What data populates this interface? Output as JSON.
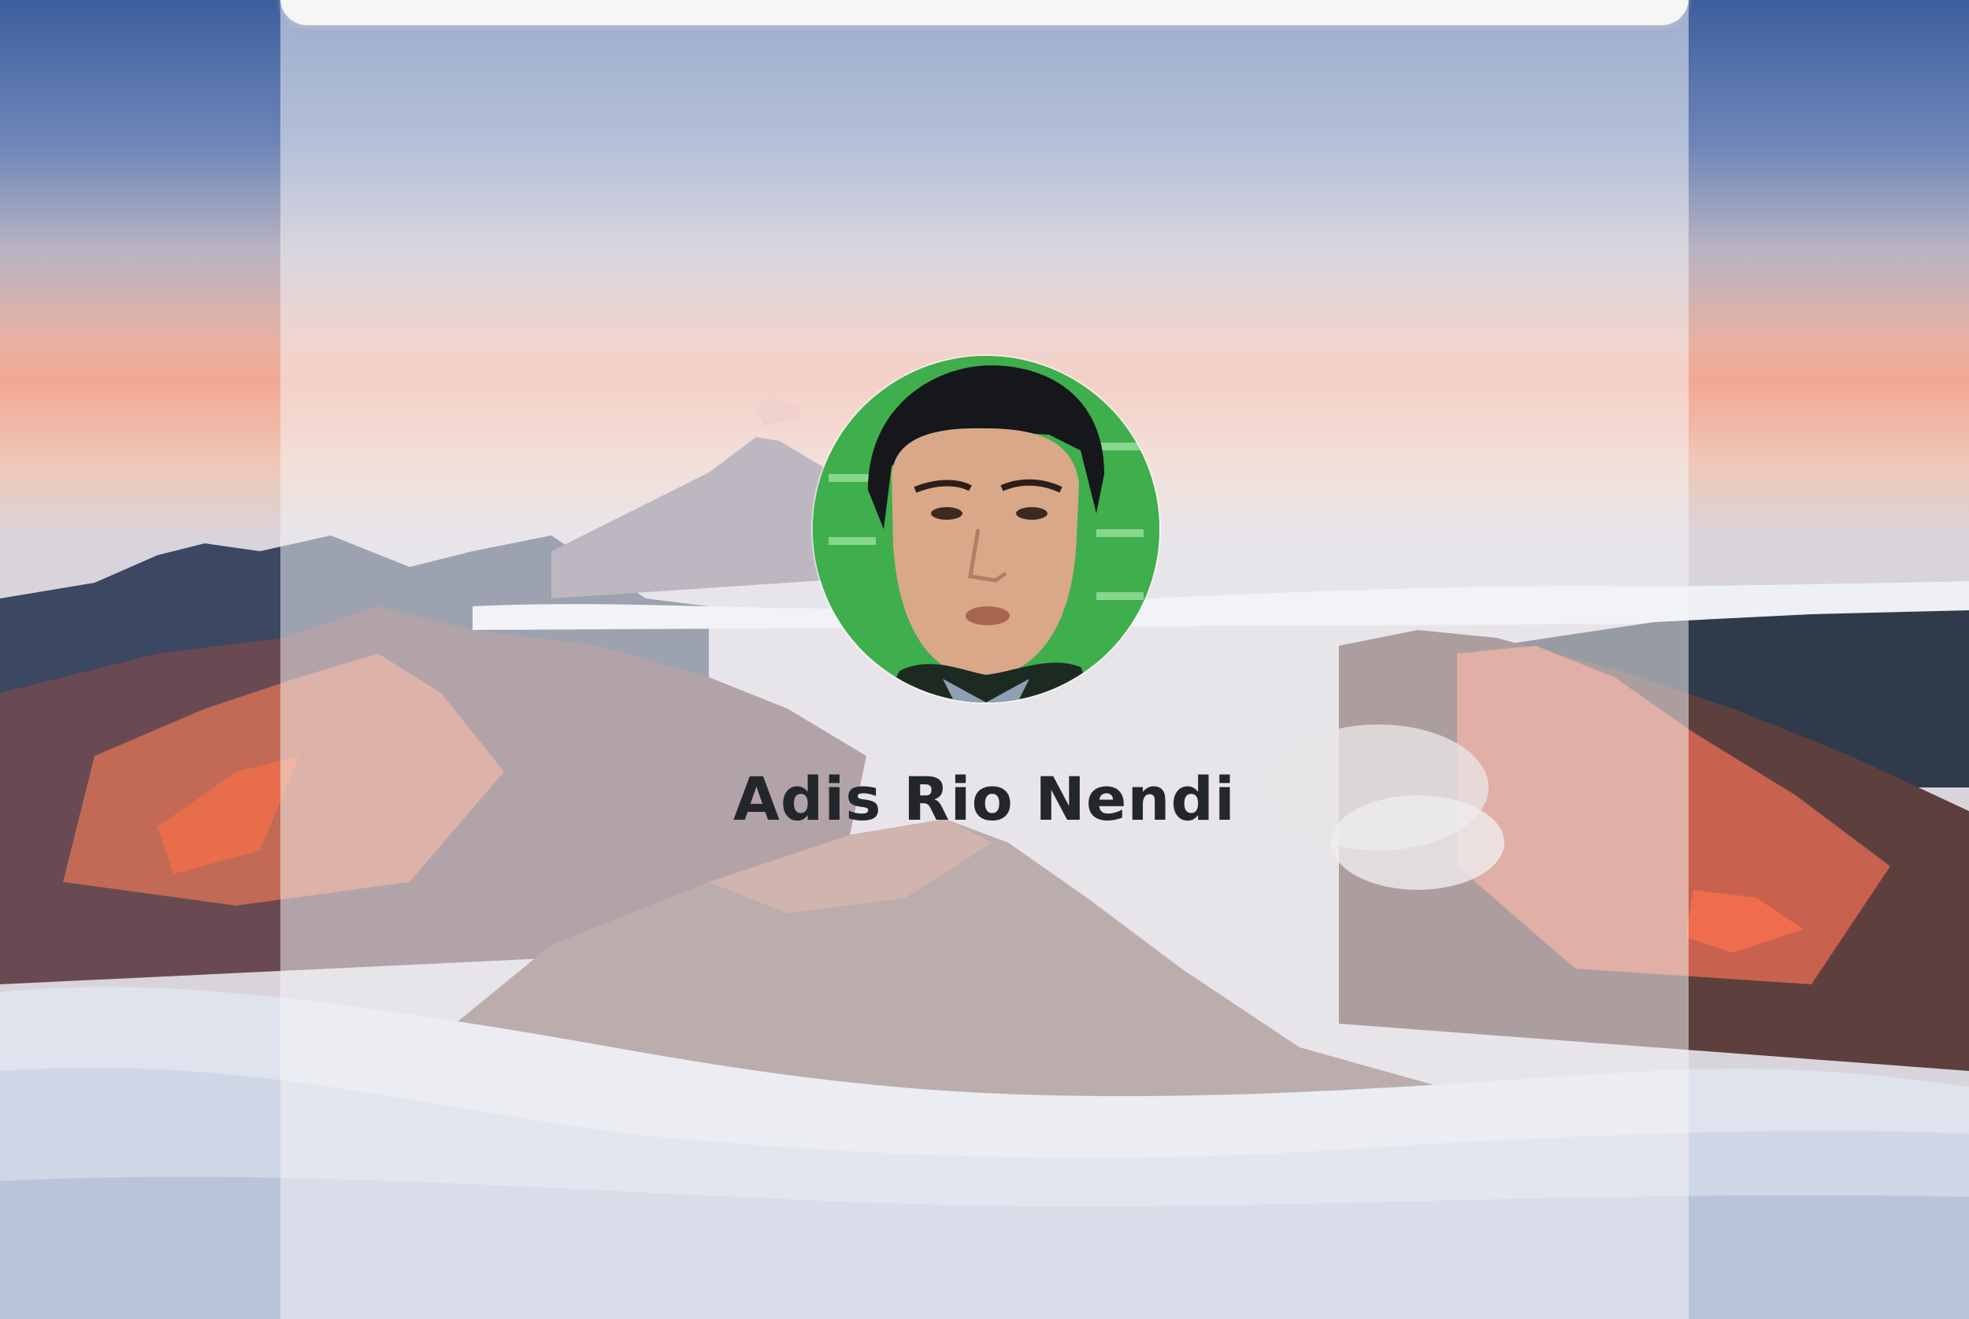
{
  "profile": {
    "name": "Adis Rio Nendi"
  },
  "icons": {
    "avatar": "profile-photo",
    "background": "mountain-landscape"
  }
}
